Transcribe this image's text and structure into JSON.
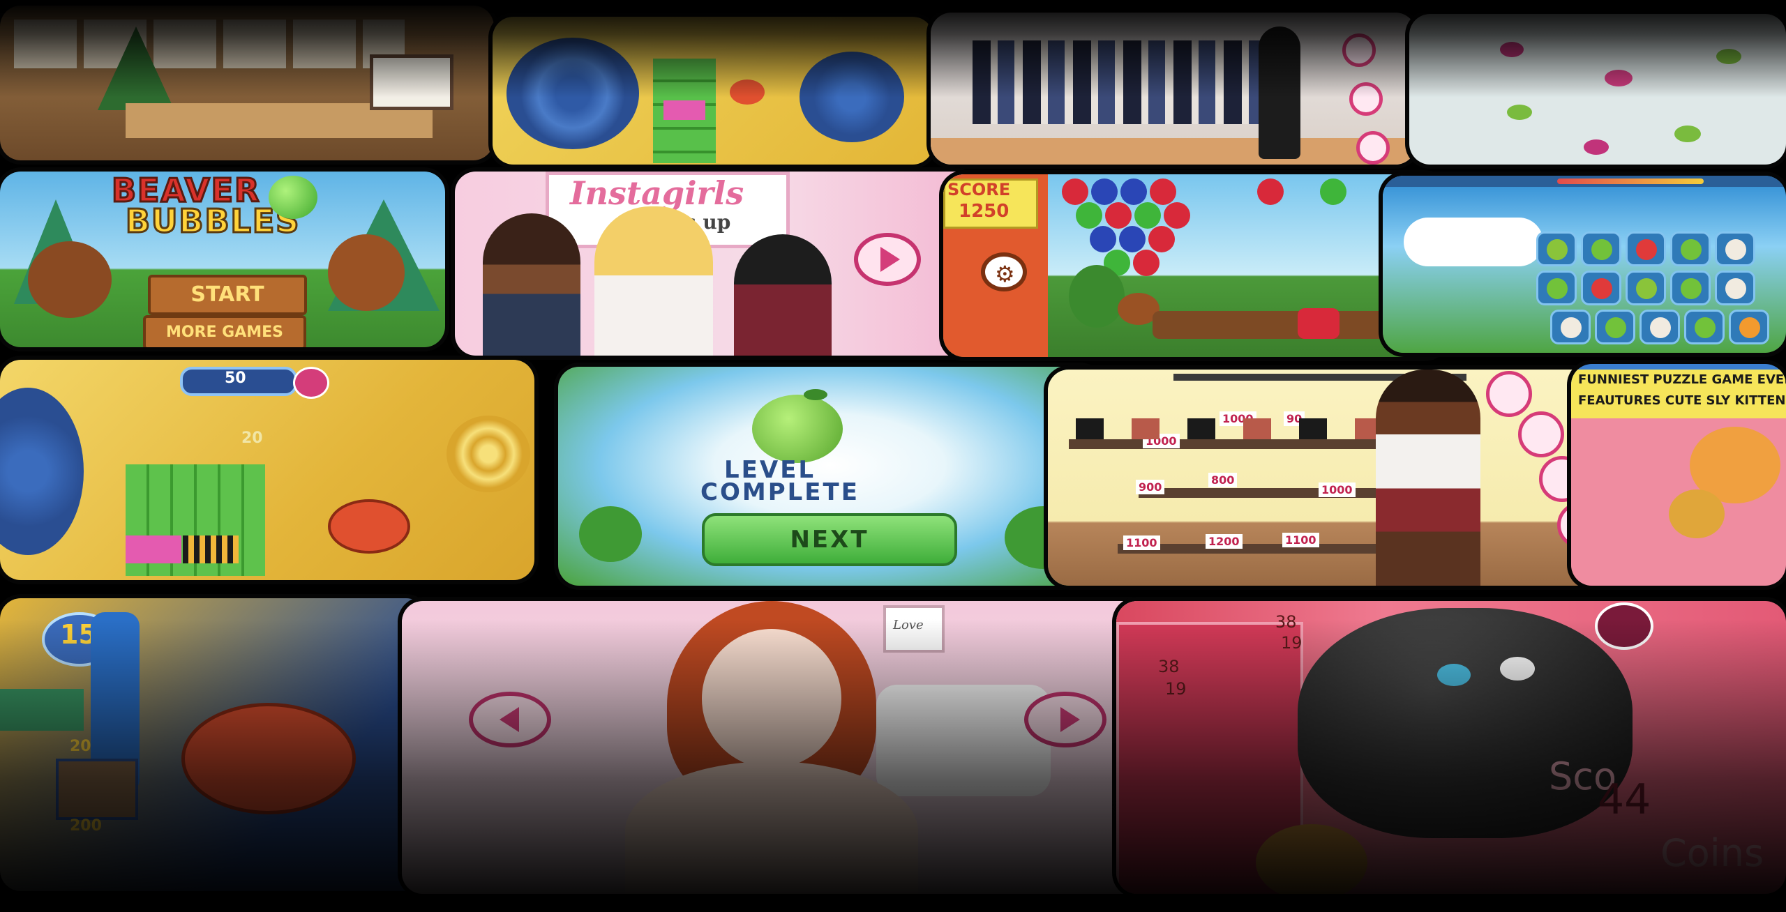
{
  "games": {
    "beaver_bubbles": {
      "title_line1": "BEAVER",
      "title_line2": "BUBBLES",
      "start_label": "START",
      "more_games_label": "MORE GAMES"
    },
    "instagirls": {
      "title": "Instagirls",
      "subtitle": "dress up"
    },
    "bubble_shooter": {
      "score_label": "SCORE",
      "score_value": "1250"
    },
    "puzzle_top": {
      "score": "50",
      "counter": "20"
    },
    "level_complete": {
      "line1": "LEVEL",
      "line2": "COMPLETE",
      "next_label": "NEXT"
    },
    "shoe_shop": {
      "prices": [
        "1000",
        "1000",
        "90",
        "900",
        "800",
        "1000",
        "1100",
        "1200",
        "1100"
      ]
    },
    "kitten_promo": {
      "line1": "FUNNIEST PUZZLE GAME EVER",
      "line2": "FEAUTURES CUTE SLY KITTEN"
    },
    "puzzle_bottom": {
      "level": "15",
      "counter": "20",
      "points": "200"
    },
    "dressup_girl": {
      "frame_text": "Love"
    },
    "cat_game": {
      "trophy1": "38",
      "sub1": "19",
      "trophy2": "38",
      "sub2": "19",
      "score_label": "Sco",
      "score_value": "44",
      "coins_label": "Coins"
    }
  },
  "colors": {
    "background": "#000000",
    "pink_accent": "#d43d7a",
    "green_button": "#5cc24a",
    "beaver_yellow": "#ffd33a",
    "beaver_red": "#d9322b"
  }
}
